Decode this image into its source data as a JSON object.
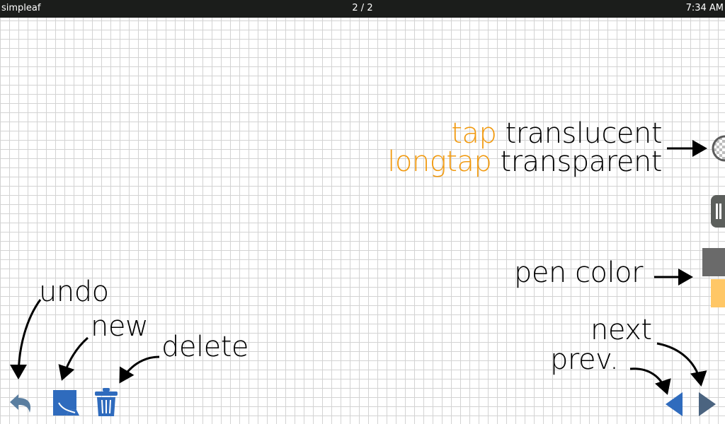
{
  "statusbar": {
    "app_name": "simpleaf",
    "page": "2 / 2",
    "time": "7:34 AM"
  },
  "hints": {
    "tap_word": "tap",
    "translucent": "translucent",
    "longtap_word": "longtap",
    "transparent": "transparent",
    "pen_color": "pen color",
    "undo": "undo",
    "new": "new",
    "delete": "delete",
    "next": "next",
    "prev": "prev."
  },
  "colors": {
    "accent": "#f19a10",
    "toolbar_blue": "#2f6bbd",
    "undo_gray": "#5a7ea0",
    "nav_blue": "#2f6bbd",
    "nav_gray": "#4b6480",
    "pen_primary": "#6a6a6a",
    "pen_secondary": "#ffc766",
    "grid_line": "#d3d3d3"
  },
  "icons": {
    "undo": "undo-icon",
    "new": "new-page-icon",
    "delete": "trash-icon",
    "prev": "prev-page-icon",
    "next": "next-page-icon",
    "transparency": "transparency-toggle-icon",
    "drawer_handle": "drawer-handle-icon"
  }
}
